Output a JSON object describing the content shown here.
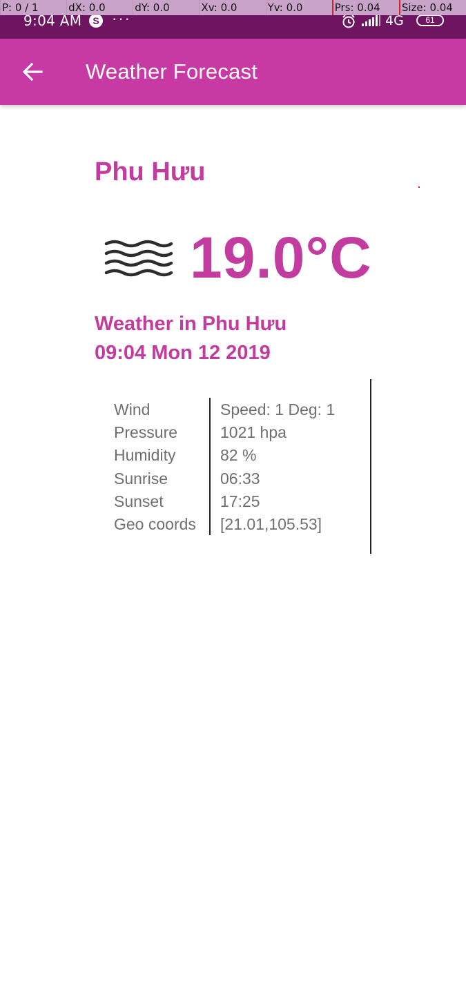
{
  "debug": {
    "pointer": "P: 0 / 1",
    "dx": "dX: 0.0",
    "dy": "dY: 0.0",
    "xv": "Xv: 0.0",
    "yv": "Yv: 0.0",
    "prs": "Prs: 0.04",
    "size": "Size: 0.04"
  },
  "status": {
    "time": "9:04 AM",
    "app_badge": "S",
    "dots": "···",
    "network": "4G",
    "battery": "61"
  },
  "app_bar": {
    "title": "Weather Forecast",
    "back_icon": "arrow-back-icon"
  },
  "weather": {
    "city": "Phu Hưu",
    "temperature": "19.0°C",
    "condition_icon": "mist-icon",
    "heading_line1": "Weather in Phu Hưu",
    "heading_line2": "09:04 Mon 12 2019",
    "details": [
      {
        "label": "Wind",
        "value": "Speed: 1 Deg: 1"
      },
      {
        "label": "Pressure",
        "value": "1021 hpa"
      },
      {
        "label": "Humidity",
        "value": "82 %"
      },
      {
        "label": "Sunrise",
        "value": "06:33"
      },
      {
        "label": "Sunset",
        "value": "17:25"
      },
      {
        "label": "Geo coords",
        "value": "[21.01,105.53]"
      }
    ]
  },
  "colors": {
    "status_bar": "#6e1461",
    "app_bar": "#c73aa4",
    "accent_text": "#c23c9f",
    "detail_text": "#6f6f6f"
  }
}
